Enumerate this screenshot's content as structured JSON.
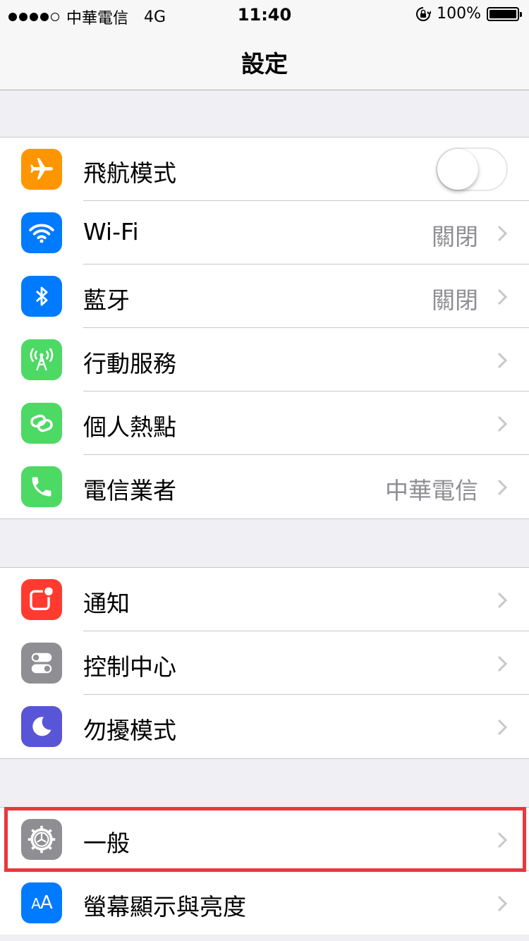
{
  "status_bar": {
    "carrier": "中華電信",
    "network": "4G",
    "time": "11:40",
    "battery": "100%",
    "signal_dots": [
      1,
      1,
      1,
      1,
      0
    ]
  },
  "nav": {
    "title": "設定"
  },
  "groups": [
    {
      "items": [
        {
          "label": "飛航模式",
          "icon": "airplane-icon",
          "icon_color": "#ff9500",
          "toggle": "off"
        },
        {
          "label": "Wi-Fi",
          "icon": "wifi-icon",
          "icon_color": "#007aff",
          "value": "關閉"
        },
        {
          "label": "藍牙",
          "icon": "bluetooth-icon",
          "icon_color": "#007aff",
          "value": "關閉"
        },
        {
          "label": "行動服務",
          "icon": "cellular-antenna-icon",
          "icon_color": "#4cd964"
        },
        {
          "label": "個人熱點",
          "icon": "hotspot-chain-icon",
          "icon_color": "#4cd964"
        },
        {
          "label": "電信業者",
          "icon": "phone-icon",
          "icon_color": "#4cd964",
          "value": "中華電信"
        }
      ]
    },
    {
      "items": [
        {
          "label": "通知",
          "icon": "notifications-icon",
          "icon_color": "#ff3b30"
        },
        {
          "label": "控制中心",
          "icon": "control-center-icon",
          "icon_color": "#8e8e93"
        },
        {
          "label": "勿擾模式",
          "icon": "moon-icon",
          "icon_color": "#5856d6"
        }
      ]
    },
    {
      "items": [
        {
          "label": "一般",
          "icon": "gear-icon",
          "icon_color": "#8e8e93",
          "highlighted": true
        },
        {
          "label": "螢幕顯示與亮度",
          "icon": "text-size-aa-icon",
          "icon_color": "#007aff"
        }
      ]
    }
  ],
  "highlight_color": "#e8383d"
}
